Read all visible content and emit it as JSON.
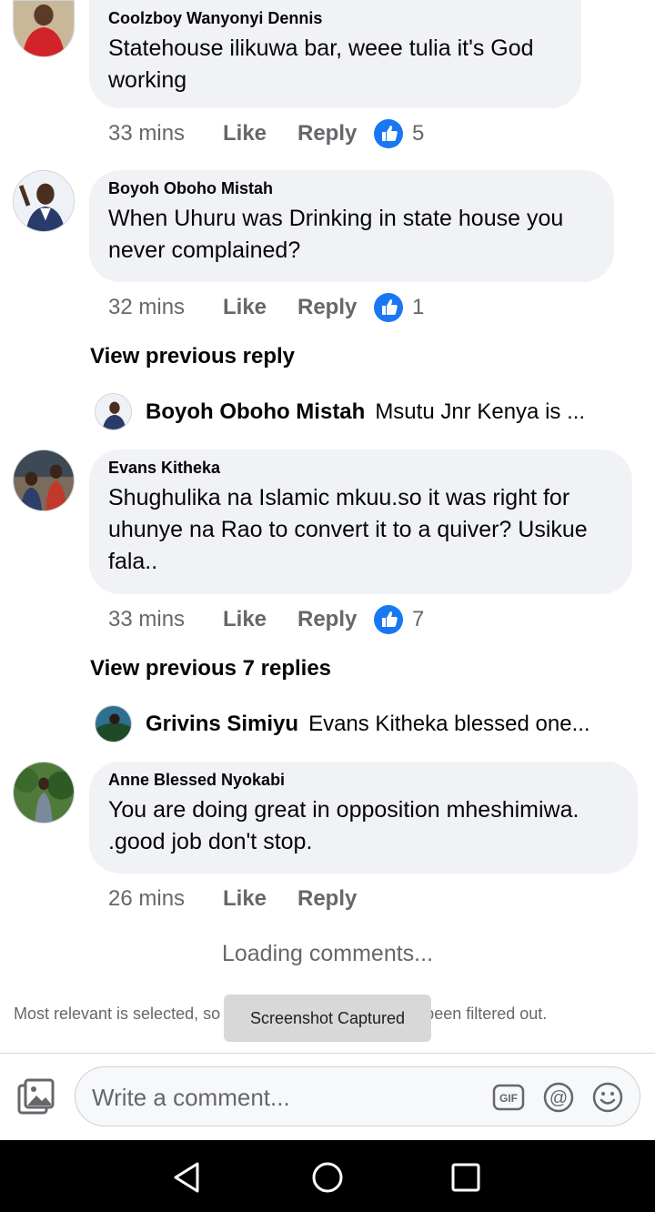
{
  "comments": [
    {
      "author": "Coolzboy Wanyonyi Dennis",
      "text_lines": [
        "Statehouse ilikuwa bar, weee tulia it's God",
        "working"
      ],
      "time": "33 mins",
      "like": "Like",
      "reply": "Reply",
      "reactions": "5"
    },
    {
      "author": "Boyoh Oboho Mistah",
      "text_lines": [
        "When Uhuru was Drinking in state house  you",
        "never complained?"
      ],
      "time": "32 mins",
      "like": "Like",
      "reply": "Reply",
      "reactions": "1",
      "view_previous": "View previous reply",
      "reply_preview": {
        "name": "Boyoh Oboho Mistah",
        "text": "Msutu Jnr Kenya is ..."
      }
    },
    {
      "author": "Evans Kitheka",
      "text_lines": [
        "Shughulika na Islamic mkuu.so it was right for",
        "uhunye na Rao to convert it to a quiver? Usikue",
        "fala.."
      ],
      "time": "33 mins",
      "like": "Like",
      "reply": "Reply",
      "reactions": "7",
      "view_previous": "View previous 7 replies",
      "reply_preview": {
        "name": "Grivins Simiyu",
        "text": "Evans Kitheka blessed one..."
      }
    },
    {
      "author": "Anne Blessed Nyokabi",
      "text_lines": [
        "You are doing great in opposition mheshimiwa.",
        ".good job don't stop."
      ],
      "time": "26 mins",
      "like": "Like",
      "reply": "Reply"
    }
  ],
  "loading": "Loading comments...",
  "filter_note": "Most relevant is selected, so some comments may have been filtered out.",
  "toast": "Screenshot Captured",
  "composer": {
    "placeholder": "Write a comment...",
    "icons": [
      "photo-icon",
      "gif-icon",
      "mention-icon",
      "emoji-icon"
    ]
  },
  "navbar": {
    "icons": [
      "back-icon",
      "home-icon",
      "recents-icon"
    ]
  },
  "colors": {
    "bubble": "#f0f2f5",
    "like_blue": "#1877f2",
    "secondary_text": "#65676b",
    "navbar": "#000000"
  }
}
